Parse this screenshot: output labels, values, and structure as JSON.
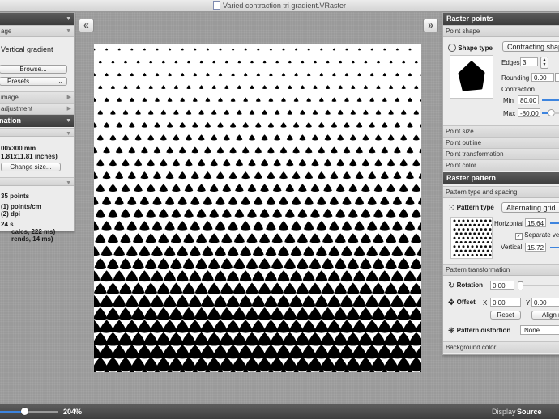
{
  "window": {
    "title": "Varied contraction tri gradient.VRaster"
  },
  "nav": {
    "back_glyph": "«",
    "forward_glyph": "»"
  },
  "left_panel": {
    "image_header": "",
    "image_subheader": "age",
    "source_name": "Vertical gradient",
    "browse_label": "Browse...",
    "presets_label": "Presets",
    "section_image": "image",
    "section_adjustment": "adjustment",
    "info_header": "nation",
    "size_text": "00x300 mm",
    "size_inches": "1.81x11.81 inches)",
    "change_size_label": "Change size...",
    "points_count": "35 points",
    "points_per_cm": "(1) points/cm",
    "dpi": "(2) dpi",
    "seconds": "24 s",
    "calcs": "calcs, 222 ms)",
    "rends": "rends, 14 ms)"
  },
  "right_panel": {
    "raster_points_header": "Raster points",
    "point_shape_section": "Point shape",
    "shape_type_label": "Shape type",
    "shape_type_value": "Contracting shap",
    "edges_label": "Edges",
    "edges_value": "3",
    "rounding_label": "Rounding",
    "rounding_value": "0.00",
    "contraction_label": "Contraction",
    "min_label": "Min",
    "min_value": "80.00",
    "max_label": "Max",
    "max_value": "-80.00",
    "point_size_section": "Point size",
    "point_outline_section": "Point outline",
    "point_transformation_section": "Point transformation",
    "point_color_section": "Point color",
    "raster_pattern_header": "Raster pattern",
    "pattern_type_spacing_section": "Pattern type and spacing",
    "pattern_type_label": "Pattern type",
    "pattern_type_value": "Alternating grid",
    "horizontal_label": "Horizontal",
    "horizontal_value": "15.64",
    "separate_label": "Separate verti",
    "vertical_label": "Vertical",
    "vertical_value": "15.72",
    "pattern_transformation_section": "Pattern transformation",
    "rotation_label": "Rotation",
    "rotation_value": "0.00",
    "offset_label": "Offset",
    "x_label": "X",
    "x_value": "0.00",
    "y_label": "Y",
    "y_value": "0.00",
    "reset_label": "Reset",
    "align_label": "Align r",
    "distortion_label": "Pattern distortion",
    "distortion_value": "None",
    "background_color_section": "Background color"
  },
  "bottom_bar": {
    "zoom_value": "204%",
    "zoom_fraction": 0.42,
    "display_label": "Display",
    "display_value": "Source"
  },
  "colors": {
    "accent_blue": "#3d84de",
    "panel_header": "#3c3c3c",
    "shape_fill": "#000000"
  }
}
